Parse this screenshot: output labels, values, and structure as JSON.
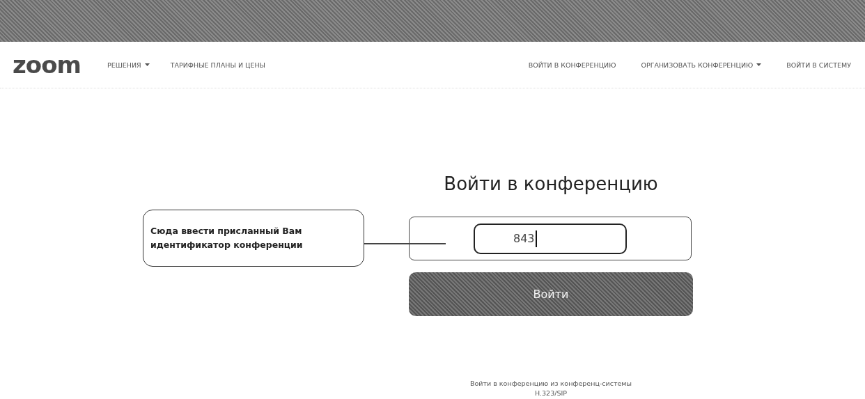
{
  "logo": "zoom",
  "nav_left": [
    {
      "label": "РЕШЕНИЯ",
      "has_menu": true
    },
    {
      "label": "ТАРИФНЫЕ ПЛАНЫ И ЦЕНЫ",
      "has_menu": false
    }
  ],
  "nav_right": [
    {
      "label": "ВОЙТИ В КОНФЕРЕНЦИЮ",
      "has_menu": false
    },
    {
      "label": "ОРГАНИЗОВАТЬ КОНФЕРЕНЦИЮ",
      "has_menu": true
    },
    {
      "label": "ВОЙТИ В СИСТЕМУ",
      "has_menu": false
    }
  ],
  "heading": "Войти в конференцию",
  "callout": "Сюда ввести присланный Вам идентификатор конференции",
  "meeting_id": {
    "value": "843"
  },
  "join_button": "Войти",
  "footer_link": [
    "Войти в конференцию из конференц-системы",
    "H.323/SIP"
  ]
}
